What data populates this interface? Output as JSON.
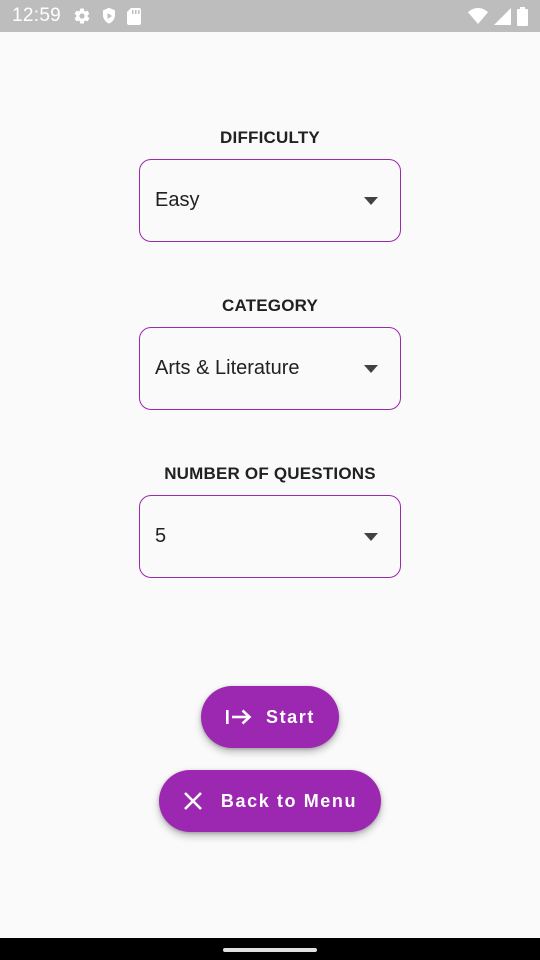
{
  "status_bar": {
    "time": "12:59",
    "left_icons": [
      "gear-icon",
      "shield-icon",
      "sd-card-icon"
    ],
    "right_icons": [
      "wifi-icon",
      "cell-signal-icon",
      "battery-icon"
    ]
  },
  "form": {
    "difficulty": {
      "label": "DIFFICULTY",
      "value": "Easy"
    },
    "category": {
      "label": "CATEGORY",
      "value": "Arts & Literature"
    },
    "questions": {
      "label": "NUMBER OF QUESTIONS",
      "value": "5"
    }
  },
  "actions": {
    "start_label": "Start",
    "start_icon": "login-arrow-icon",
    "back_label": "Back to Menu",
    "back_icon": "close-icon"
  },
  "colors": {
    "accent": "#9c27b0",
    "background": "#fafafa",
    "status_bar": "#bdbdbd",
    "text": "#212121"
  }
}
